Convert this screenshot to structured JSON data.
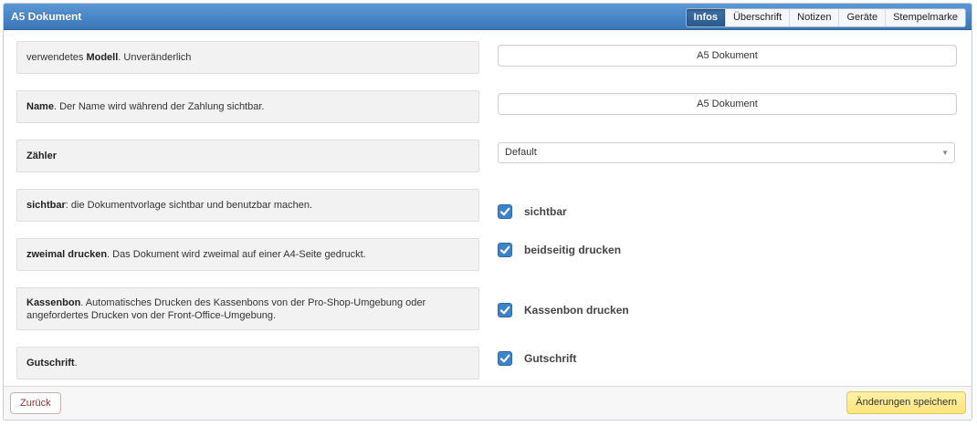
{
  "header": {
    "title": "A5 Dokument",
    "tabs": [
      {
        "label": "Infos",
        "active": true
      },
      {
        "label": "Überschrift",
        "active": false
      },
      {
        "label": "Notizen",
        "active": false
      },
      {
        "label": "Geräte",
        "active": false
      },
      {
        "label": "Stempelmarke",
        "active": false
      }
    ]
  },
  "rows": {
    "model": {
      "bold": "Modell",
      "pre": "verwendetes ",
      "post": ". Unveränderlich",
      "value": "A5 Dokument"
    },
    "name": {
      "bold": "Name",
      "post": ". Der Name wird während der Zahlung sichtbar.",
      "value": "A5 Dokument"
    },
    "counter": {
      "bold": "Zähler",
      "value": "Default"
    },
    "visible": {
      "bold": "sichtbar",
      "post": ": die Dokumentvorlage sichtbar und benutzbar machen.",
      "check_label": "sichtbar",
      "checked": true
    },
    "double_print": {
      "bold": "zweimal drucken",
      "post": ". Das Dokument wird zweimal auf einer A4-Seite gedruckt.",
      "check_label": "beidseitig drucken",
      "checked": true
    },
    "receipt": {
      "bold": "Kassenbon",
      "post": ". Automatisches Drucken des Kassenbons von der Pro-Shop-Umgebung oder angefordertes Drucken von der Front-Office-Umgebung.",
      "check_label": "Kassenbon drucken",
      "checked": true
    },
    "credit": {
      "bold": "Gutschrift",
      "post": ".",
      "check_label": "Gutschrift",
      "checked": true
    }
  },
  "footer": {
    "back_label": "Zurück",
    "save_label": "Änderungen speichern"
  },
  "colors": {
    "header_blue": "#3a76b8",
    "checkbox_blue": "#3e83c9",
    "save_yellow": "#fde47c"
  }
}
